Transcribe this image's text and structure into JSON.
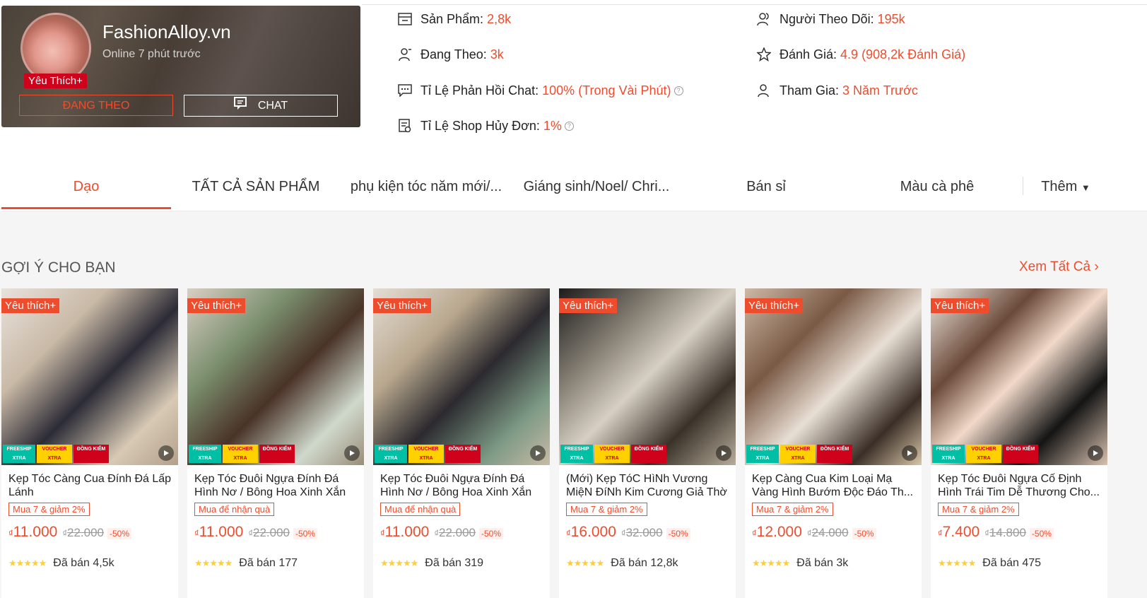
{
  "shop": {
    "name": "FashionAlloy.vn",
    "online": "Online 7 phút trước",
    "badge": "Yêu Thích+",
    "follow_label": "ĐANG THEO",
    "chat_label": "CHAT"
  },
  "stats": {
    "products": {
      "label": "Sản Phẩm:",
      "value": "2,8k"
    },
    "following": {
      "label": "Đang Theo:",
      "value": "3k"
    },
    "chat_rate": {
      "label": "Tỉ Lệ Phản Hồi Chat:",
      "value": "100% (Trong Vài Phút)"
    },
    "cancel_rate": {
      "label": "Tỉ Lệ Shop Hủy Đơn:",
      "value": "1%"
    },
    "followers": {
      "label": "Người Theo Dõi:",
      "value": "195k"
    },
    "rating": {
      "label": "Đánh Giá:",
      "value": "4.9 (908,2k Đánh Giá)"
    },
    "joined": {
      "label": "Tham Gia:",
      "value": "3 Năm Trước"
    }
  },
  "tabs": [
    "Dạo",
    "TẤT CẢ SẢN PHẨM",
    "phụ kiện tóc năm mới/...",
    "Giáng sinh/Noel/ Chri...",
    "Bán sỉ",
    "Màu cà phê"
  ],
  "tabs_more": "Thêm",
  "section": {
    "title": "GỢI Ý CHO BẠN",
    "see_all": "Xem Tất Cả"
  },
  "card_badges": {
    "freeship": "FREESHIP",
    "xtra": "XTRA",
    "voucher": "VOUCHER",
    "dong_kiem": "ĐỒNG KIỂM"
  },
  "currency": "₫",
  "products": [
    {
      "badge": "Yêu thích+",
      "name": "Kẹp Tóc Càng Cua Đính Đá Lấp Lánh",
      "promo": "Mua 7 & giảm 2%",
      "price": "11.000",
      "old_price": "22.000",
      "discount": "-50%",
      "sold": "Đã bán 4,5k"
    },
    {
      "badge": "Yêu thích+",
      "name": "Kẹp Tóc Đuôi Ngựa Đính Đá Hình Nơ / Bông Hoa Xinh Xắn",
      "promo": "Mua để nhận quà",
      "price": "11.000",
      "old_price": "22.000",
      "discount": "-50%",
      "sold": "Đã bán 177"
    },
    {
      "badge": "Yêu thích+",
      "name": "Kẹp Tóc Đuôi Ngựa Đính Đá Hình Nơ / Bông Hoa Xinh Xắn",
      "promo": "Mua để nhận quà",
      "price": "11.000",
      "old_price": "22.000",
      "discount": "-50%",
      "sold": "Đã bán 319"
    },
    {
      "badge": "Yêu thích+",
      "name": "(Mới) Kẹp TóC HìNh Vương MiệN ĐíNh Kim Cương Giả Thờ",
      "promo": "Mua 7 & giảm 2%",
      "price": "16.000",
      "old_price": "32.000",
      "discount": "-50%",
      "sold": "Đã bán 12,8k"
    },
    {
      "badge": "Yêu thích+",
      "name": "Kẹp Càng Cua Kim Loại Mạ Vàng Hình Bướm Độc Đáo Th...",
      "promo": "Mua 7 & giảm 2%",
      "price": "12.000",
      "old_price": "24.000",
      "discount": "-50%",
      "sold": "Đã bán 3k"
    },
    {
      "badge": "Yêu thích+",
      "name": "Kẹp Tóc Đuôi Ngựa Cố Định Hình Trái Tim Dễ Thương Cho...",
      "promo": "Mua 7 & giảm 2%",
      "price": "7.400",
      "old_price": "14.800",
      "discount": "-50%",
      "sold": "Đã bán 475"
    }
  ]
}
